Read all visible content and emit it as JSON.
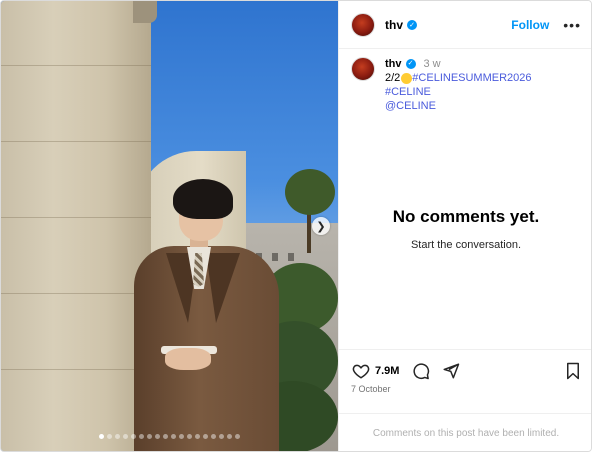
{
  "post": {
    "username": "thv",
    "follow_label": "Follow",
    "more_label": "•••",
    "caption": {
      "username": "thv",
      "time_ago": "3 w",
      "prefix": "2/2",
      "hashtag_1": "#CELINESUMMER2026",
      "hashtag_2": "#CELINE",
      "mention": "@CELINE"
    },
    "empty_state": {
      "title": "No comments yet.",
      "subtitle": "Start the conversation."
    },
    "likes": "7.9M",
    "date": "7 October",
    "comments_limited": "Comments on this post have been limited."
  },
  "carousel": {
    "slide_count": 18,
    "active_index": 0,
    "next_icon": "chevron-right-icon"
  },
  "icons": {
    "verified": "verified-badge-icon",
    "like": "heart-icon",
    "comment": "comment-bubble-icon",
    "share": "paper-plane-icon",
    "save": "bookmark-icon"
  },
  "colors": {
    "accent": "#0095f6",
    "hashtag": "#4a5bdc"
  }
}
